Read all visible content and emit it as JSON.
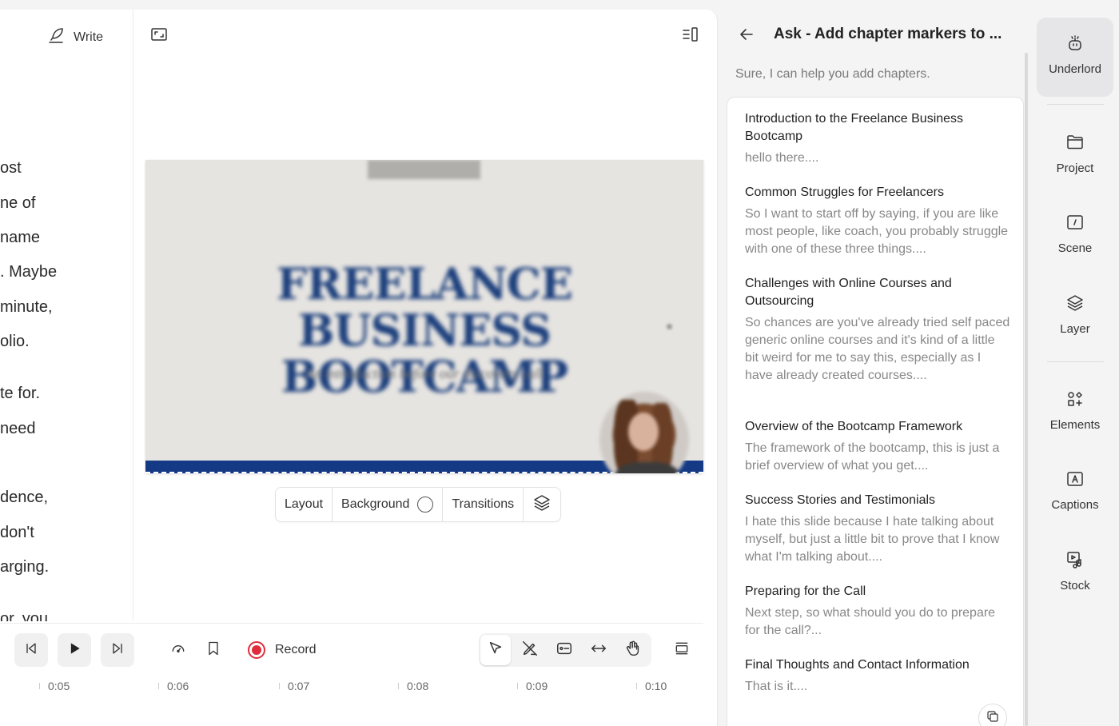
{
  "editor": {
    "write_label": "Write",
    "script_lines": [
      "ost",
      "ne of",
      " name",
      ". Maybe",
      "minute,",
      "olio.",
      "te for.",
      " need",
      "dence,",
      "don't",
      "arging.",
      "or, you"
    ]
  },
  "slide_controls": {
    "layout": "Layout",
    "background": "Background",
    "transitions": "Transitions"
  },
  "transport": {
    "record": "Record",
    "ticks": [
      "0:05",
      "0:06",
      "0:07",
      "0:08",
      "0:09",
      "0:10"
    ]
  },
  "ask": {
    "title": "Ask - Add chapter markers to ...",
    "intro": "Sure, I can help you add chapters.",
    "chapters": [
      {
        "title": "Introduction to the Freelance Business Bootcamp",
        "desc": "hello there...."
      },
      {
        "title": "Common Struggles for Freelancers",
        "desc": "So I want to start off by saying, if you are like most people, like coach, you probably struggle with one of these three things...."
      },
      {
        "title": "Challenges with Online Courses and Outsourcing",
        "desc": "So chances are you've already tried self paced generic online courses and it's kind of a little bit weird for me to say this, especially as I have already created courses...."
      },
      {
        "title": "Overview of the Bootcamp Framework",
        "desc": "The framework of the bootcamp, this is just a brief overview of what you get...."
      },
      {
        "title": "Success Stories and Testimonials",
        "desc": "I hate this slide because I hate talking about myself, but just a little bit to prove that I know what I'm talking about...."
      },
      {
        "title": "Preparing for the Call",
        "desc": "Next step, so what should you do to prepare for the call?..."
      },
      {
        "title": "Final Thoughts and Contact Information",
        "desc": "That is it...."
      }
    ]
  },
  "rail": {
    "underlord": "Underlord",
    "project": "Project",
    "scene": "Scene",
    "layer": "Layer",
    "elements": "Elements",
    "captions": "Captions",
    "stock": "Stock"
  },
  "colors": {
    "accent_record": "#e02d3c",
    "slide_title": "#1c3f7c",
    "slide_bar": "#143a86"
  }
}
